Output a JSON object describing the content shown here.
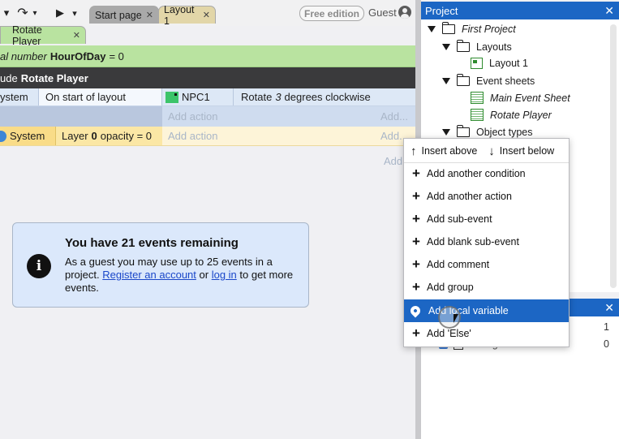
{
  "toolbar": {
    "undo_glyph": "↶",
    "redo_glyph": "↷",
    "play_glyph": "▶",
    "dropdown_glyph": "▾",
    "free_edition": "Free edition",
    "guest": "Guest"
  },
  "tabs": [
    {
      "label": "Start page",
      "close": "✕"
    },
    {
      "label": "Layout 1",
      "close": "✕"
    },
    {
      "label": "Rotate Player",
      "close": "✕"
    }
  ],
  "sheet": {
    "var_prefix": "al number",
    "var_name": "HourOfDay",
    "var_suffix": "= 0",
    "include_prefix": "ude",
    "include_name": "Rotate Player",
    "event1": {
      "object": "ystem",
      "condition": "On start of layout",
      "action_object": "NPC1",
      "action_pre": "Rotate",
      "action_num": "3",
      "action_post": "degrees clockwise",
      "add_action": "Add action",
      "add_dots": "Add..."
    },
    "event2": {
      "object": "System",
      "cond_pre": "Layer",
      "cond_num": "0",
      "cond_post": "opacity = 0",
      "add_action": "Add action",
      "add_dots": "Add..."
    },
    "trailing_add": "Add"
  },
  "info": {
    "icon": "i",
    "title": "You have 21 events remaining",
    "line1": "As a guest you may use up to 25 events in a project.",
    "link_register": "Register an account",
    "or": "or",
    "link_login": "log in",
    "line2": "to get more events."
  },
  "project": {
    "title": "Project",
    "close": "✕",
    "tree": [
      {
        "label": "First Project",
        "italic": true
      },
      {
        "label": "Layouts"
      },
      {
        "label": "Layout 1"
      },
      {
        "label": "Event sheets"
      },
      {
        "label": "Main Event Sheet",
        "italic": true
      },
      {
        "label": "Rotate Player",
        "italic": true
      },
      {
        "label": "Object types"
      }
    ]
  },
  "layers": {
    "close": "✕",
    "rows": [
      {
        "label": "",
        "count": "1"
      },
      {
        "label": "Background",
        "count": "0"
      }
    ]
  },
  "context_menu": {
    "insert_above": "Insert above",
    "insert_below": "Insert below",
    "items": [
      "Add another condition",
      "Add another action",
      "Add sub-event",
      "Add blank sub-event",
      "Add comment",
      "Add group",
      "Add local variable",
      "Add 'Else'"
    ],
    "highlight_index": 6
  },
  "colors": {
    "accent": "#1c66c4",
    "variable_row": "#b9e3a0",
    "include_row": "#3a3a3c",
    "event_row": "#dde8f6",
    "system_row": "#fdf4d8",
    "info_box": "#dbe8fb"
  }
}
